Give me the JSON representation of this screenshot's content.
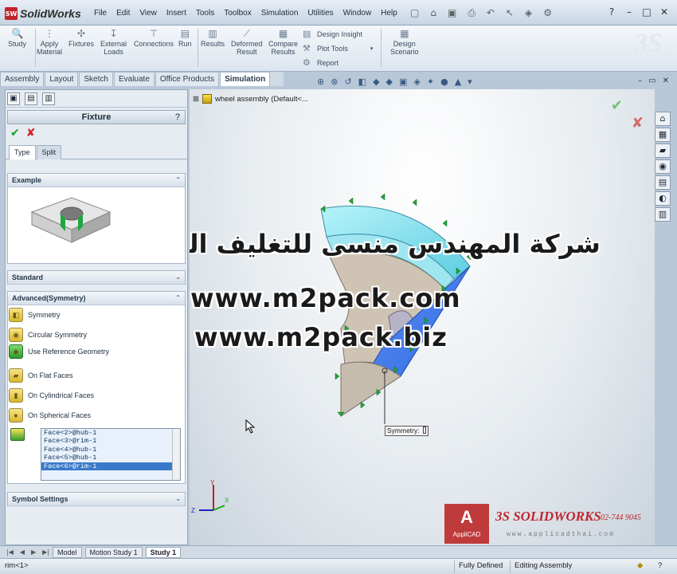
{
  "app": {
    "name": "SolidWorks",
    "badge": "SW"
  },
  "menu": [
    "File",
    "Edit",
    "View",
    "Insert",
    "Tools",
    "Toolbox",
    "Simulation",
    "Utilities",
    "Window",
    "Help"
  ],
  "quick_toolbar": [
    "new-doc-icon",
    "open-icon",
    "save-icon",
    "print-icon",
    "undo-icon",
    "select-icon",
    "rebuild-icon",
    "options-icon"
  ],
  "window_controls": [
    "?",
    "–",
    "□",
    "✕"
  ],
  "command_manager": {
    "study": "Study",
    "apply_material": [
      "Apply",
      "Material"
    ],
    "fixtures": "Fixtures",
    "external_loads": [
      "External",
      "Loads"
    ],
    "connections": "Connections",
    "run": "Run",
    "results": "Results",
    "deformed_result": [
      "Deformed",
      "Result"
    ],
    "compare_results": [
      "Compare",
      "Results"
    ],
    "design_insight": "Design Insight",
    "plot_tools": "Plot Tools",
    "report": "Report",
    "design_scenario": [
      "Design",
      "Scenario"
    ]
  },
  "tabs": [
    "Assembly",
    "Layout",
    "Sketch",
    "Evaluate",
    "Office Products",
    "Simulation"
  ],
  "property_manager": {
    "title": "Fixture",
    "help": "?",
    "type_tabs": [
      "Type",
      "Split"
    ],
    "groups": {
      "example": "Example",
      "standard": "Standard",
      "advanced": "Advanced(Symmetry)",
      "symbol_settings": "Symbol Settings"
    },
    "options": {
      "symmetry": "Symmetry",
      "circular_symmetry": "Circular Symmetry",
      "use_reference_geometry": "Use Reference Geometry",
      "on_flat_faces": "On Flat Faces",
      "on_cylindrical_faces": "On Cylindrical Faces",
      "on_spherical_faces": "On Spherical Faces"
    },
    "faces": [
      "Face<2>@hub-1",
      "Face<3>@rim-1",
      "Face<4>@hub-1",
      "Face<5>@hub-1",
      "Face<6>@rim-1"
    ],
    "selected_face_index": 4
  },
  "viewport": {
    "tree_root": "wheel assembly  (Default<...",
    "symmetry_callout": "Symmetry:",
    "watermark_arabic": "شركة المهندس منسى للتغليف الحديث",
    "watermark_url1": "www.m2pack.com",
    "watermark_url2": "www.m2pack.biz",
    "triad": {
      "x": "X",
      "y": "Y",
      "z": "Z"
    }
  },
  "brand": {
    "applicad": "AppliCAD",
    "mark": "A",
    "solidworks": "3S SOLIDWORKS",
    "phone": "02-744 9045",
    "web": "www.applicadthai.com"
  },
  "bottom_tabs": [
    "Model",
    "Motion Study 1",
    "Study 1"
  ],
  "status": {
    "left": "rim<1>",
    "fully_defined": "Fully Defined",
    "editing": "Editing Assembly"
  },
  "colors": {
    "accent": "#3a79c9",
    "model_cyan": "#8fe4f0",
    "model_blue": "#3e7ef0",
    "model_tan": "#cfc4b4"
  }
}
